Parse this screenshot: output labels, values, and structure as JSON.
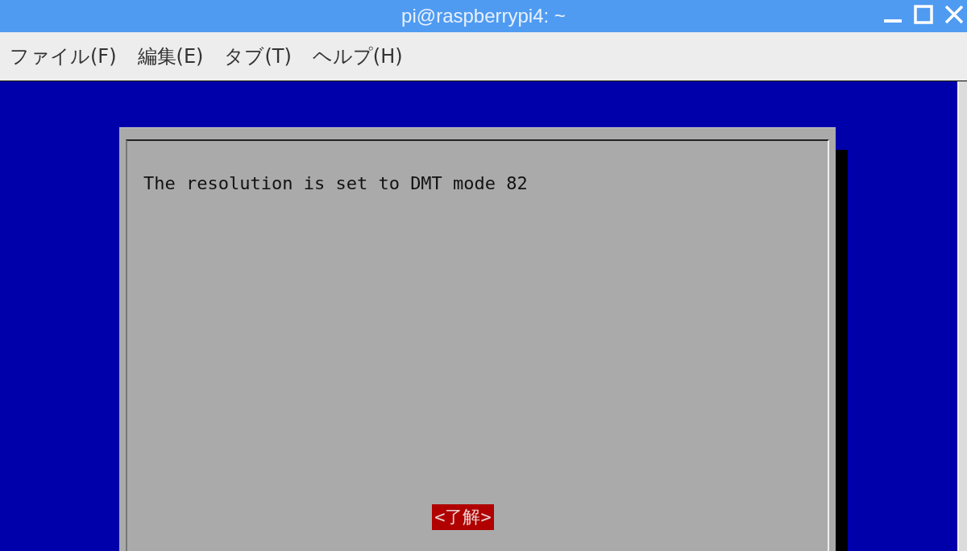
{
  "window": {
    "title": "pi@raspberrypi4: ~"
  },
  "menu": [
    {
      "label": "ファイル(F)"
    },
    {
      "label": "編集(E)"
    },
    {
      "label": "タブ(T)"
    },
    {
      "label": "ヘルプ(H)"
    }
  ],
  "dialog": {
    "message": "The resolution is set to DMT mode 82",
    "buttons": [
      {
        "label": "<了解>",
        "selected": true
      }
    ]
  }
}
